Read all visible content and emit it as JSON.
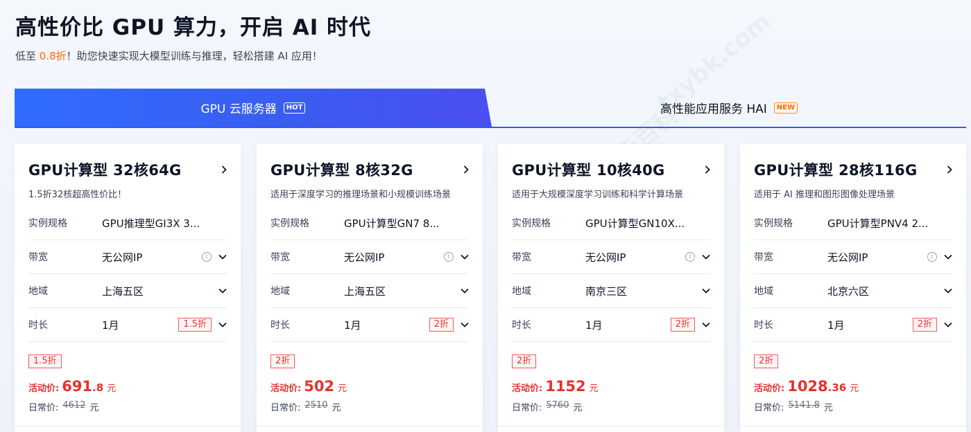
{
  "header": {
    "title": "高性价比 GPU 算力，开启 AI 时代",
    "subtitle_pre": "低至",
    "subtitle_highlight": "0.8折",
    "subtitle_post": "！助您快速实现大模型训练与推理，轻松搭建 AI 应用！"
  },
  "tabs": [
    {
      "label": "GPU 云服务器",
      "badge": "HOT",
      "active": true
    },
    {
      "label": "高性能应用服务 HAI",
      "badge": "NEW",
      "active": false
    }
  ],
  "spec_labels": {
    "instance": "实例规格",
    "bandwidth": "带宽",
    "region": "地域",
    "duration": "时长",
    "promo_price": "活动价:",
    "regular_price": "日常价:",
    "currency": "元"
  },
  "cards": [
    {
      "title": "GPU计算型 32核64G",
      "desc": "1.5折32核超高性价比！",
      "instance": "GPU推理型GI3X 3...",
      "bandwidth": "无公网IP",
      "region": "上海五区",
      "duration": "1月",
      "duration_discount": "1.5折",
      "promo_tag": "1.5折",
      "price_int": "691",
      "price_dec": ".8",
      "regular_price": "4612"
    },
    {
      "title": "GPU计算型 8核32G",
      "desc": "适用于深度学习的推理场景和小规模训练场景",
      "instance": "GPU计算型GN7 8...",
      "bandwidth": "无公网IP",
      "region": "上海五区",
      "duration": "1月",
      "duration_discount": "2折",
      "promo_tag": "2折",
      "price_int": "502",
      "price_dec": "",
      "regular_price": "2510"
    },
    {
      "title": "GPU计算型 10核40G",
      "desc": "适用于大规模深度学习训练和科学计算场景",
      "instance": "GPU计算型GN10X...",
      "bandwidth": "无公网IP",
      "region": "南京三区",
      "duration": "1月",
      "duration_discount": "2折",
      "promo_tag": "2折",
      "price_int": "1152",
      "price_dec": "",
      "regular_price": "5760"
    },
    {
      "title": "GPU计算型 28核116G",
      "desc": "适用于 AI 推理和图形图像处理场景",
      "instance": "GPU计算型PNV4 2...",
      "bandwidth": "无公网IP",
      "region": "北京六区",
      "duration": "1月",
      "duration_discount": "2折",
      "promo_tag": "2折",
      "price_int": "1028",
      "price_dec": ".36",
      "regular_price": "5141.8"
    }
  ],
  "watermarks": [
    "txybk.com",
    "腾讯云百科"
  ],
  "colors": {
    "accent": "#2f5cf0",
    "price": "#e5322d",
    "highlight": "#ff6a00"
  }
}
